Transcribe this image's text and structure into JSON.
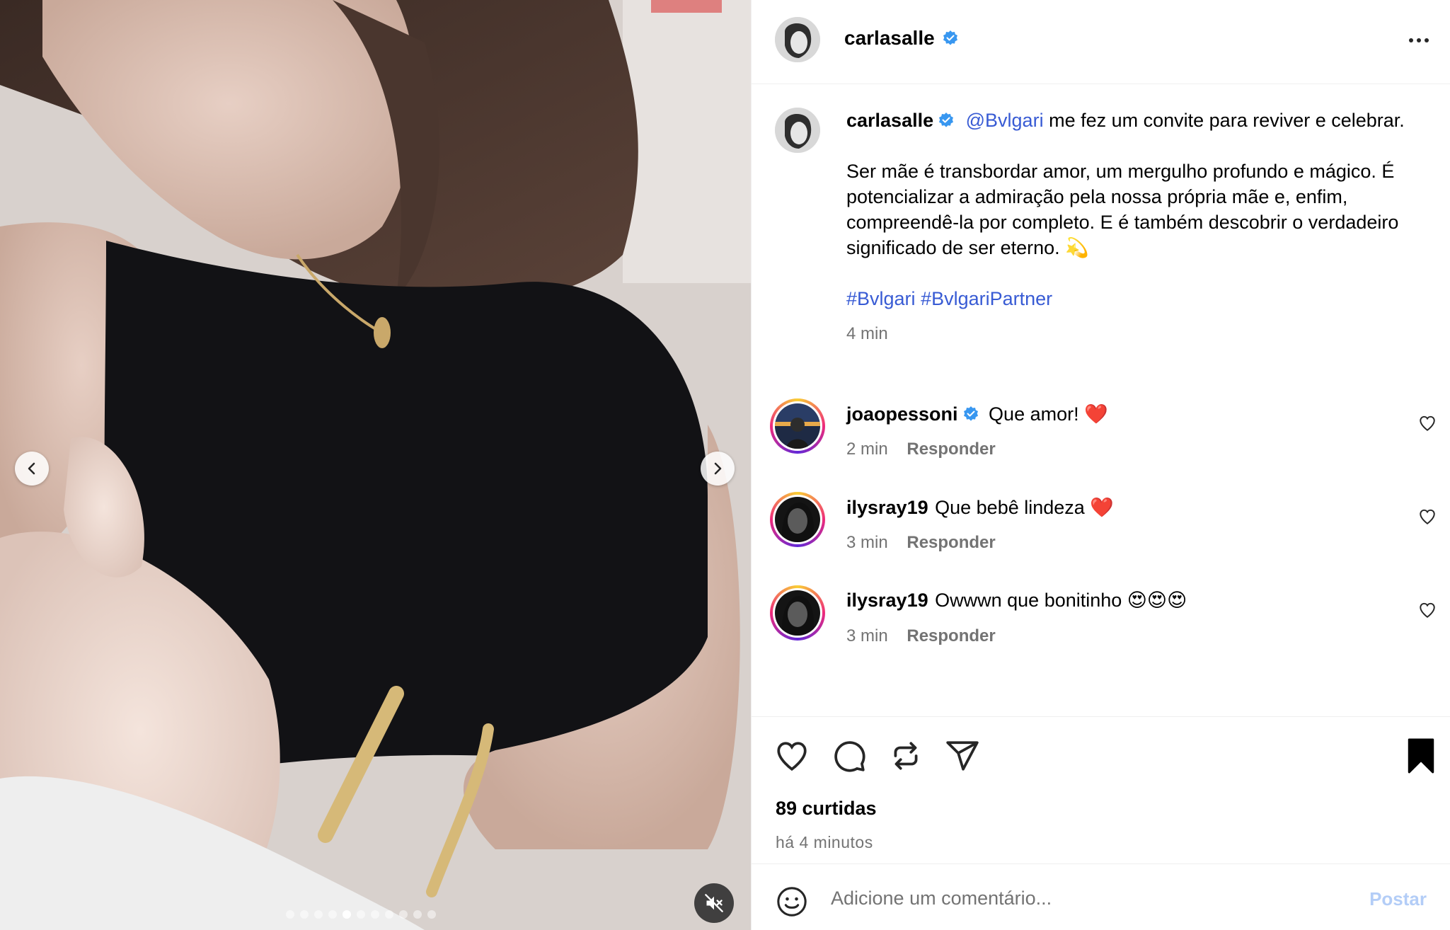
{
  "post": {
    "author": "carlasalle",
    "media": {
      "carousel_total": 11,
      "carousel_active": 4,
      "mute_state": "muted"
    },
    "caption": {
      "username": "carlasalle",
      "mention": "@Bvlgari",
      "line1_rest": " me fez um convite para reviver e celebrar.",
      "paragraph2": "Ser mãe é transbordar amor, um mergulho profundo e mágico. É potencializar a admiração pela nossa própria mãe e, enfim, compreendê-la por completo. E é também descobrir o verdadeiro significado de ser eterno. 💫",
      "hashtag1": "#Bvlgari",
      "hashtag2": "#BvlgariPartner",
      "time": "4 min"
    },
    "comments": [
      {
        "username": "joaopessoni",
        "verified": true,
        "text": "Que amor! ❤️",
        "time": "2 min",
        "reply": "Responder"
      },
      {
        "username": "ilysray19",
        "verified": false,
        "text": "Que bebê lindeza ❤️",
        "time": "3 min",
        "reply": "Responder"
      },
      {
        "username": "ilysray19",
        "verified": false,
        "text": "Owwwn que bonitinho 😍😍😍",
        "time": "3 min",
        "reply": "Responder"
      }
    ],
    "likes": "89 curtidas",
    "posted": "há 4 minutos",
    "add_comment": {
      "placeholder": "Adicione um comentário...",
      "post_label": "Postar"
    }
  },
  "colors": {
    "link": "#385bd4",
    "verified": "#3897f0",
    "secondary_text": "#737373",
    "post_button_disabled": "#b3cdf7"
  },
  "icons": [
    "verified-badge-icon",
    "more-options-icon",
    "chevron-left-icon",
    "chevron-right-icon",
    "mute-icon",
    "heart-icon",
    "comment-icon",
    "repost-icon",
    "share-icon",
    "bookmark-icon",
    "emoji-icon"
  ]
}
